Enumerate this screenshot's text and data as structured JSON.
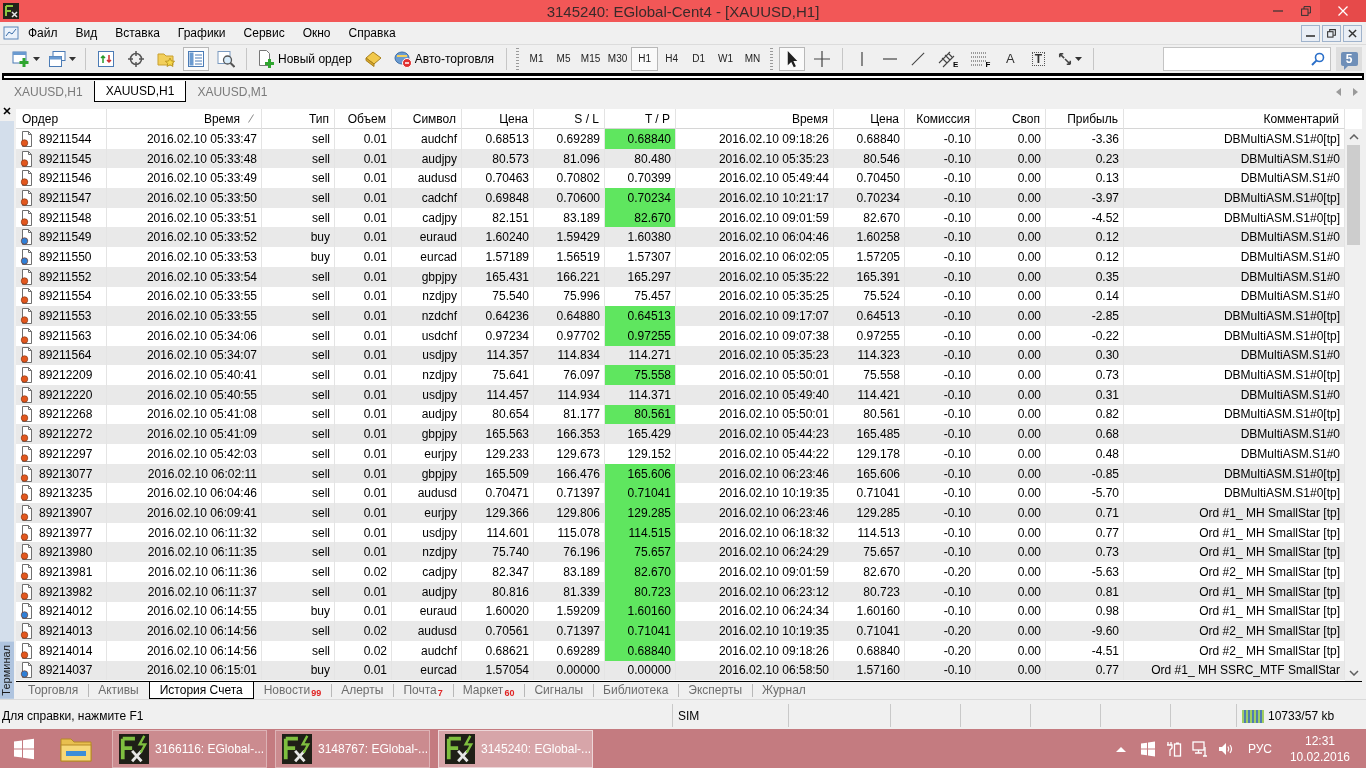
{
  "window": {
    "title": "3145240: EGlobal-Cent4 - [XAUUSD,H1]"
  },
  "menu": [
    "Файл",
    "Вид",
    "Вставка",
    "Графики",
    "Сервис",
    "Окно",
    "Справка"
  ],
  "toolbar": {
    "chart_tools": [
      {
        "kind": "new_chart"
      },
      {
        "kind": "profiles"
      }
    ],
    "window_tools": [
      {
        "kind": "market_watch",
        "on": false
      },
      {
        "kind": "navigator",
        "on": false
      },
      {
        "kind": "favorites",
        "on": false
      },
      {
        "kind": "terminal",
        "on": true
      },
      {
        "kind": "tester",
        "on": false
      }
    ],
    "actions": [
      {
        "kind": "new_order",
        "label": "Новый ордер"
      },
      {
        "kind": "editor"
      },
      {
        "kind": "autotrading",
        "label": "Авто-торговля"
      }
    ],
    "timeframes": [
      {
        "label": "M1",
        "selected": false
      },
      {
        "label": "M5",
        "selected": false
      },
      {
        "label": "M15",
        "selected": false
      },
      {
        "label": "M30",
        "selected": false
      },
      {
        "label": "H1",
        "selected": true
      },
      {
        "label": "H4",
        "selected": false
      },
      {
        "label": "D1",
        "selected": false
      },
      {
        "label": "W1",
        "selected": false
      },
      {
        "label": "MN",
        "selected": false
      }
    ],
    "draw_tools": [
      {
        "kind": "cursor",
        "selected": true
      },
      {
        "kind": "crosshair",
        "selected": false
      },
      {
        "kind": "vline",
        "selected": false
      },
      {
        "kind": "hline",
        "selected": false
      },
      {
        "kind": "trendline",
        "selected": false
      },
      {
        "kind": "channel",
        "label": "E",
        "selected": false
      },
      {
        "kind": "fibo",
        "label": "F",
        "selected": false
      },
      {
        "kind": "text",
        "label": "A",
        "selected": false
      },
      {
        "kind": "text_label",
        "label": "T",
        "selected": false
      },
      {
        "kind": "arrows",
        "selected": false
      }
    ],
    "messages": "5"
  },
  "chart_tabs": [
    {
      "label": "XAUUSD,H1",
      "selected": false
    },
    {
      "label": "XAUUSD,H1",
      "selected": true
    },
    {
      "label": "XAUUSD,M1",
      "selected": false
    }
  ],
  "terminal": {
    "label": "Терминал",
    "table": {
      "columns": [
        {
          "label": "Ордер",
          "sorted": false
        },
        {
          "label": "Время",
          "sorted": true
        },
        {
          "label": "Тип",
          "sorted": false
        },
        {
          "label": "Объем",
          "sorted": false
        },
        {
          "label": "Символ",
          "sorted": false
        },
        {
          "label": "Цена",
          "sorted": false
        },
        {
          "label": "S / L",
          "sorted": false
        },
        {
          "label": "T / P",
          "sorted": false
        },
        {
          "label": "Время",
          "sorted": false
        },
        {
          "label": "Цена",
          "sorted": false
        },
        {
          "label": "Комиссия",
          "sorted": false
        },
        {
          "label": "Своп",
          "sorted": false
        },
        {
          "label": "Прибыль",
          "sorted": false
        },
        {
          "label": "Комментарий",
          "sorted": false
        }
      ],
      "rows": [
        {
          "kind": "sell",
          "tp_highlighted": true,
          "cells": [
            "89211544",
            "2016.02.10 05:33:47",
            "sell",
            "0.01",
            "audchf",
            "0.68513",
            "0.69289",
            "0.68840",
            "2016.02.10 09:18:26",
            "0.68840",
            "-0.10",
            "0.00",
            "-3.36",
            "DBMultiASM.S1#0[tp]"
          ]
        },
        {
          "kind": "sell",
          "tp_highlighted": false,
          "cells": [
            "89211545",
            "2016.02.10 05:33:48",
            "sell",
            "0.01",
            "audjpy",
            "80.573",
            "81.096",
            "80.480",
            "2016.02.10 05:35:23",
            "80.546",
            "-0.10",
            "0.00",
            "0.23",
            "DBMultiASM.S1#0"
          ]
        },
        {
          "kind": "sell",
          "tp_highlighted": false,
          "cells": [
            "89211546",
            "2016.02.10 05:33:49",
            "sell",
            "0.01",
            "audusd",
            "0.70463",
            "0.70802",
            "0.70399",
            "2016.02.10 05:49:44",
            "0.70450",
            "-0.10",
            "0.00",
            "0.13",
            "DBMultiASM.S1#0"
          ]
        },
        {
          "kind": "sell",
          "tp_highlighted": true,
          "cells": [
            "89211547",
            "2016.02.10 05:33:50",
            "sell",
            "0.01",
            "cadchf",
            "0.69848",
            "0.70600",
            "0.70234",
            "2016.02.10 10:21:17",
            "0.70234",
            "-0.10",
            "0.00",
            "-3.97",
            "DBMultiASM.S1#0[tp]"
          ]
        },
        {
          "kind": "sell",
          "tp_highlighted": true,
          "cells": [
            "89211548",
            "2016.02.10 05:33:51",
            "sell",
            "0.01",
            "cadjpy",
            "82.151",
            "83.189",
            "82.670",
            "2016.02.10 09:01:59",
            "82.670",
            "-0.10",
            "0.00",
            "-4.52",
            "DBMultiASM.S1#0[tp]"
          ]
        },
        {
          "kind": "buy",
          "tp_highlighted": false,
          "cells": [
            "89211549",
            "2016.02.10 05:33:52",
            "buy",
            "0.01",
            "euraud",
            "1.60240",
            "1.59429",
            "1.60380",
            "2016.02.10 06:04:46",
            "1.60258",
            "-0.10",
            "0.00",
            "0.12",
            "DBMultiASM.S1#0"
          ]
        },
        {
          "kind": "buy",
          "tp_highlighted": false,
          "cells": [
            "89211550",
            "2016.02.10 05:33:53",
            "buy",
            "0.01",
            "eurcad",
            "1.57189",
            "1.56519",
            "1.57307",
            "2016.02.10 06:02:05",
            "1.57205",
            "-0.10",
            "0.00",
            "0.12",
            "DBMultiASM.S1#0"
          ]
        },
        {
          "kind": "sell",
          "tp_highlighted": false,
          "cells": [
            "89211552",
            "2016.02.10 05:33:54",
            "sell",
            "0.01",
            "gbpjpy",
            "165.431",
            "166.221",
            "165.297",
            "2016.02.10 05:35:22",
            "165.391",
            "-0.10",
            "0.00",
            "0.35",
            "DBMultiASM.S1#0"
          ]
        },
        {
          "kind": "sell",
          "tp_highlighted": false,
          "cells": [
            "89211554",
            "2016.02.10 05:33:55",
            "sell",
            "0.01",
            "nzdjpy",
            "75.540",
            "75.996",
            "75.457",
            "2016.02.10 05:35:25",
            "75.524",
            "-0.10",
            "0.00",
            "0.14",
            "DBMultiASM.S1#0"
          ]
        },
        {
          "kind": "sell",
          "tp_highlighted": true,
          "cells": [
            "89211553",
            "2016.02.10 05:33:55",
            "sell",
            "0.01",
            "nzdchf",
            "0.64236",
            "0.64880",
            "0.64513",
            "2016.02.10 09:17:07",
            "0.64513",
            "-0.10",
            "0.00",
            "-2.85",
            "DBMultiASM.S1#0[tp]"
          ]
        },
        {
          "kind": "sell",
          "tp_highlighted": true,
          "cells": [
            "89211563",
            "2016.02.10 05:34:06",
            "sell",
            "0.01",
            "usdchf",
            "0.97234",
            "0.97702",
            "0.97255",
            "2016.02.10 09:07:38",
            "0.97255",
            "-0.10",
            "0.00",
            "-0.22",
            "DBMultiASM.S1#0[tp]"
          ]
        },
        {
          "kind": "sell",
          "tp_highlighted": false,
          "cells": [
            "89211564",
            "2016.02.10 05:34:07",
            "sell",
            "0.01",
            "usdjpy",
            "114.357",
            "114.834",
            "114.271",
            "2016.02.10 05:35:23",
            "114.323",
            "-0.10",
            "0.00",
            "0.30",
            "DBMultiASM.S1#0"
          ]
        },
        {
          "kind": "sell",
          "tp_highlighted": true,
          "cells": [
            "89212209",
            "2016.02.10 05:40:41",
            "sell",
            "0.01",
            "nzdjpy",
            "75.641",
            "76.097",
            "75.558",
            "2016.02.10 05:50:01",
            "75.558",
            "-0.10",
            "0.00",
            "0.73",
            "DBMultiASM.S1#0[tp]"
          ]
        },
        {
          "kind": "sell",
          "tp_highlighted": false,
          "cells": [
            "89212220",
            "2016.02.10 05:40:55",
            "sell",
            "0.01",
            "usdjpy",
            "114.457",
            "114.934",
            "114.371",
            "2016.02.10 05:49:40",
            "114.421",
            "-0.10",
            "0.00",
            "0.31",
            "DBMultiASM.S1#0"
          ]
        },
        {
          "kind": "sell",
          "tp_highlighted": true,
          "cells": [
            "89212268",
            "2016.02.10 05:41:08",
            "sell",
            "0.01",
            "audjpy",
            "80.654",
            "81.177",
            "80.561",
            "2016.02.10 05:50:01",
            "80.561",
            "-0.10",
            "0.00",
            "0.82",
            "DBMultiASM.S1#0[tp]"
          ]
        },
        {
          "kind": "sell",
          "tp_highlighted": false,
          "cells": [
            "89212272",
            "2016.02.10 05:41:09",
            "sell",
            "0.01",
            "gbpjpy",
            "165.563",
            "166.353",
            "165.429",
            "2016.02.10 05:44:23",
            "165.485",
            "-0.10",
            "0.00",
            "0.68",
            "DBMultiASM.S1#0"
          ]
        },
        {
          "kind": "sell",
          "tp_highlighted": false,
          "cells": [
            "89212297",
            "2016.02.10 05:42:03",
            "sell",
            "0.01",
            "eurjpy",
            "129.233",
            "129.673",
            "129.152",
            "2016.02.10 05:44:22",
            "129.178",
            "-0.10",
            "0.00",
            "0.48",
            "DBMultiASM.S1#0"
          ]
        },
        {
          "kind": "sell",
          "tp_highlighted": true,
          "cells": [
            "89213077",
            "2016.02.10 06:02:11",
            "sell",
            "0.01",
            "gbpjpy",
            "165.509",
            "166.476",
            "165.606",
            "2016.02.10 06:23:46",
            "165.606",
            "-0.10",
            "0.00",
            "-0.85",
            "DBMultiASM.S1#0[tp]"
          ]
        },
        {
          "kind": "sell",
          "tp_highlighted": true,
          "cells": [
            "89213235",
            "2016.02.10 06:04:46",
            "sell",
            "0.01",
            "audusd",
            "0.70471",
            "0.71397",
            "0.71041",
            "2016.02.10 10:19:35",
            "0.71041",
            "-0.10",
            "0.00",
            "-5.70",
            "DBMultiASM.S1#0[tp]"
          ]
        },
        {
          "kind": "sell",
          "tp_highlighted": true,
          "cells": [
            "89213907",
            "2016.02.10 06:09:41",
            "sell",
            "0.01",
            "eurjpy",
            "129.366",
            "129.806",
            "129.285",
            "2016.02.10 06:23:46",
            "129.285",
            "-0.10",
            "0.00",
            "0.71",
            "Ord #1_ MH SmallStar [tp]"
          ]
        },
        {
          "kind": "sell",
          "tp_highlighted": true,
          "cells": [
            "89213977",
            "2016.02.10 06:11:32",
            "sell",
            "0.01",
            "usdjpy",
            "114.601",
            "115.078",
            "114.515",
            "2016.02.10 06:18:32",
            "114.513",
            "-0.10",
            "0.00",
            "0.77",
            "Ord #1_ MH SmallStar [tp]"
          ]
        },
        {
          "kind": "sell",
          "tp_highlighted": true,
          "cells": [
            "89213980",
            "2016.02.10 06:11:35",
            "sell",
            "0.01",
            "nzdjpy",
            "75.740",
            "76.196",
            "75.657",
            "2016.02.10 06:24:29",
            "75.657",
            "-0.10",
            "0.00",
            "0.73",
            "Ord #1_ MH SmallStar [tp]"
          ]
        },
        {
          "kind": "sell",
          "tp_highlighted": true,
          "cells": [
            "89213981",
            "2016.02.10 06:11:36",
            "sell",
            "0.02",
            "cadjpy",
            "82.347",
            "83.189",
            "82.670",
            "2016.02.10 09:01:59",
            "82.670",
            "-0.20",
            "0.00",
            "-5.63",
            "Ord #2_ MH SmallStar [tp]"
          ]
        },
        {
          "kind": "sell",
          "tp_highlighted": true,
          "cells": [
            "89213982",
            "2016.02.10 06:11:37",
            "sell",
            "0.01",
            "audjpy",
            "80.816",
            "81.339",
            "80.723",
            "2016.02.10 06:23:12",
            "80.723",
            "-0.10",
            "0.00",
            "0.81",
            "Ord #1_ MH SmallStar [tp]"
          ]
        },
        {
          "kind": "buy",
          "tp_highlighted": true,
          "cells": [
            "89214012",
            "2016.02.10 06:14:55",
            "buy",
            "0.01",
            "euraud",
            "1.60020",
            "1.59209",
            "1.60160",
            "2016.02.10 06:24:34",
            "1.60160",
            "-0.10",
            "0.00",
            "0.98",
            "Ord #1_ MH SmallStar [tp]"
          ]
        },
        {
          "kind": "sell",
          "tp_highlighted": true,
          "cells": [
            "89214013",
            "2016.02.10 06:14:56",
            "sell",
            "0.02",
            "audusd",
            "0.70561",
            "0.71397",
            "0.71041",
            "2016.02.10 10:19:35",
            "0.71041",
            "-0.20",
            "0.00",
            "-9.60",
            "Ord #2_ MH SmallStar [tp]"
          ]
        },
        {
          "kind": "sell",
          "tp_highlighted": true,
          "cells": [
            "89214014",
            "2016.02.10 06:14:56",
            "sell",
            "0.02",
            "audchf",
            "0.68621",
            "0.69289",
            "0.68840",
            "2016.02.10 09:18:26",
            "0.68840",
            "-0.20",
            "0.00",
            "-4.51",
            "Ord #2_ MH SmallStar [tp]"
          ]
        },
        {
          "kind": "buy",
          "tp_highlighted": false,
          "cells": [
            "89214037",
            "2016.02.10 06:15:01",
            "buy",
            "0.01",
            "eurcad",
            "1.57054",
            "0.00000",
            "0.00000",
            "2016.02.10 06:58:50",
            "1.57160",
            "-0.10",
            "0.00",
            "0.77",
            "Ord #1_ MH SSRC_MTF SmallStar"
          ]
        }
      ]
    },
    "tabs": [
      {
        "label": "Торговля",
        "selected": false
      },
      {
        "label": "Активы",
        "selected": false
      },
      {
        "label": "История Счета",
        "selected": true
      },
      {
        "label": "Новости",
        "badge": "99",
        "selected": false
      },
      {
        "label": "Алерты",
        "selected": false
      },
      {
        "label": "Почта",
        "badge": "7",
        "selected": false
      },
      {
        "label": "Маркет",
        "badge": "60",
        "selected": false
      },
      {
        "label": "Сигналы",
        "selected": false
      },
      {
        "label": "Библиотека",
        "selected": false
      },
      {
        "label": "Эксперты",
        "selected": false
      },
      {
        "label": "Журнал",
        "selected": false
      }
    ]
  },
  "status_bar": {
    "help": "Для справки, нажмите F1",
    "server": "SIM",
    "traffic": "10733/57 kb"
  },
  "taskbar": {
    "tasks": [
      {
        "label": "3166116: EGlobal-...",
        "selected": false
      },
      {
        "label": "3148767: EGlobal-...",
        "selected": false
      },
      {
        "label": "3145240: EGlobal-...",
        "selected": true
      }
    ],
    "language": "РУС",
    "time": "12:31",
    "date": "10.02.2016"
  }
}
